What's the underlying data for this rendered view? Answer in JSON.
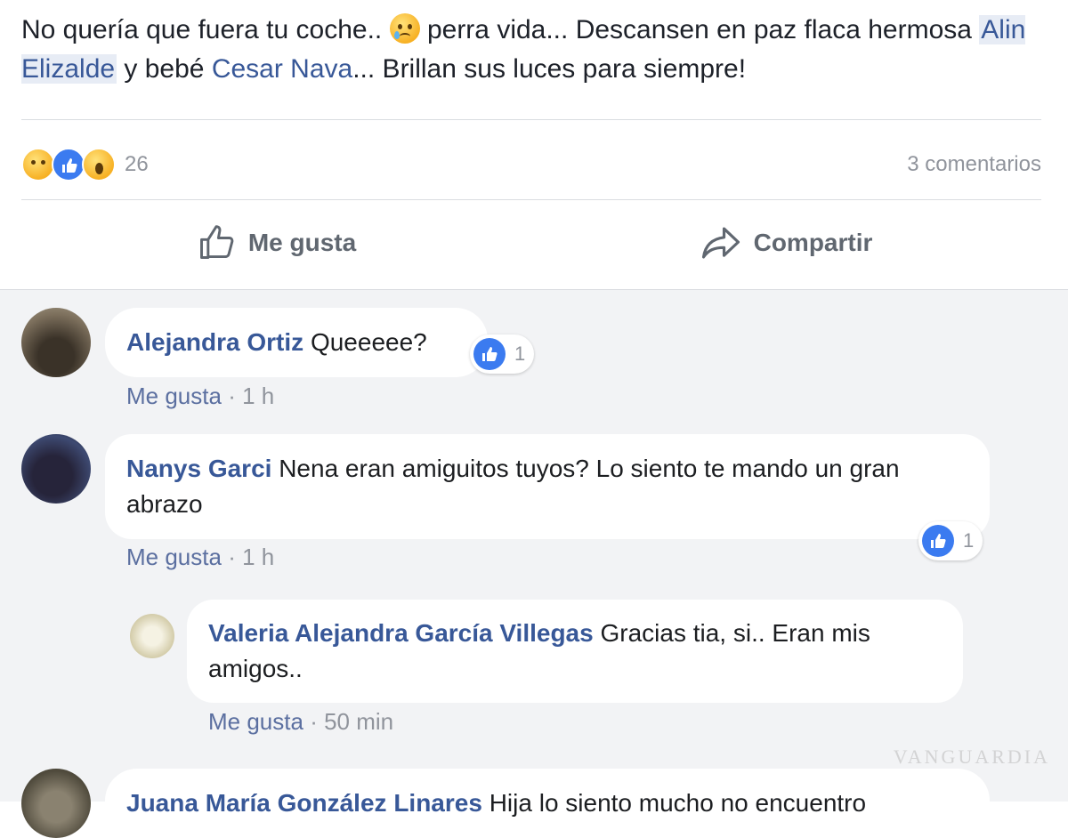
{
  "post": {
    "text_1": "No quería que fuera tu coche.. ",
    "text_2": " perra vida... Descansen en paz flaca hermosa ",
    "mention_1": "Alin Elizalde",
    "text_3": " y bebé ",
    "mention_2": "Cesar Nava",
    "text_4": "... Brillan sus luces para siempre!"
  },
  "reactions": {
    "icons": [
      "sad-reaction-icon",
      "like-reaction-icon",
      "wow-reaction-icon"
    ],
    "count": "26",
    "comments_count": "3 comentarios"
  },
  "actions": {
    "like_label": "Me gusta",
    "share_label": "Compartir"
  },
  "comments": [
    {
      "author": "Alejandra Ortiz",
      "text": "Queeeee?",
      "like_label": "Me gusta",
      "time": "1 h",
      "likes": "1"
    },
    {
      "author": "Nanys Garci",
      "text": "Nena eran amiguitos tuyos? Lo siento te mando un gran abrazo",
      "like_label": "Me gusta",
      "time": "1 h",
      "likes": "1"
    },
    {
      "author": "Valeria Alejandra García Villegas",
      "text": "Gracias tia, si.. Eran mis amigos..",
      "like_label": "Me gusta",
      "time": "50 min"
    },
    {
      "author": "Juana María González Linares",
      "text": "Hija lo siento mucho no encuentro"
    }
  ],
  "separator": "·",
  "watermark": "VANGUARDIA",
  "colors": {
    "link": "#385898",
    "like_blue": "#3b7bf0",
    "muted": "#90949c",
    "comments_bg": "#f2f3f5"
  }
}
